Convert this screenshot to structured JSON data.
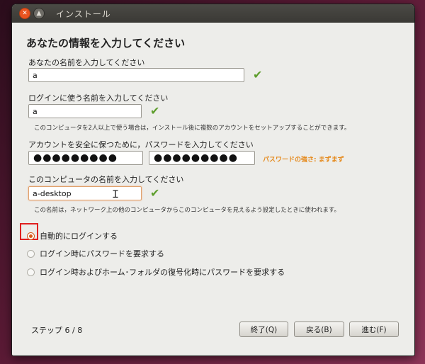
{
  "window": {
    "title": "インストール"
  },
  "page": {
    "heading": "あなたの情報を入力してください"
  },
  "name": {
    "label": "あなたの名前を入力してください",
    "value": "a"
  },
  "login": {
    "label": "ログインに使う名前を入力してください",
    "value": "a",
    "note": "このコンピュータを2人以上で使う場合は，インストール後に複数のアカウントをセットアップすることができます。"
  },
  "password": {
    "label": "アカウントを安全に保つために，パスワードを入力してください",
    "mask": "●●●●●●●●●",
    "confirm_mask": "●●●●●●●●●",
    "strength": "パスワードの強さ: まずまず"
  },
  "computer": {
    "label": "このコンピュータの名前を入力してください",
    "value": "a-desktop",
    "note": "この名前は，ネットワーク上の他のコンピュータからこのコンピュータを見えるよう設定したときに使われます。"
  },
  "login_options": [
    {
      "label": "自動的にログインする",
      "selected": true
    },
    {
      "label": "ログイン時にパスワードを要求する",
      "selected": false
    },
    {
      "label": "ログイン時およびホーム･フォルダの復号化時にパスワードを要求する",
      "selected": false
    }
  ],
  "footer": {
    "step_label": "ステップ 6 / 8",
    "quit": "終了(Q)",
    "back": "戻る(B)",
    "forward": "進む(F)"
  },
  "colors": {
    "accent": "#e95420",
    "check": "#5e9e2d",
    "strength": "#e58a1d",
    "highlight": "#e02020"
  }
}
